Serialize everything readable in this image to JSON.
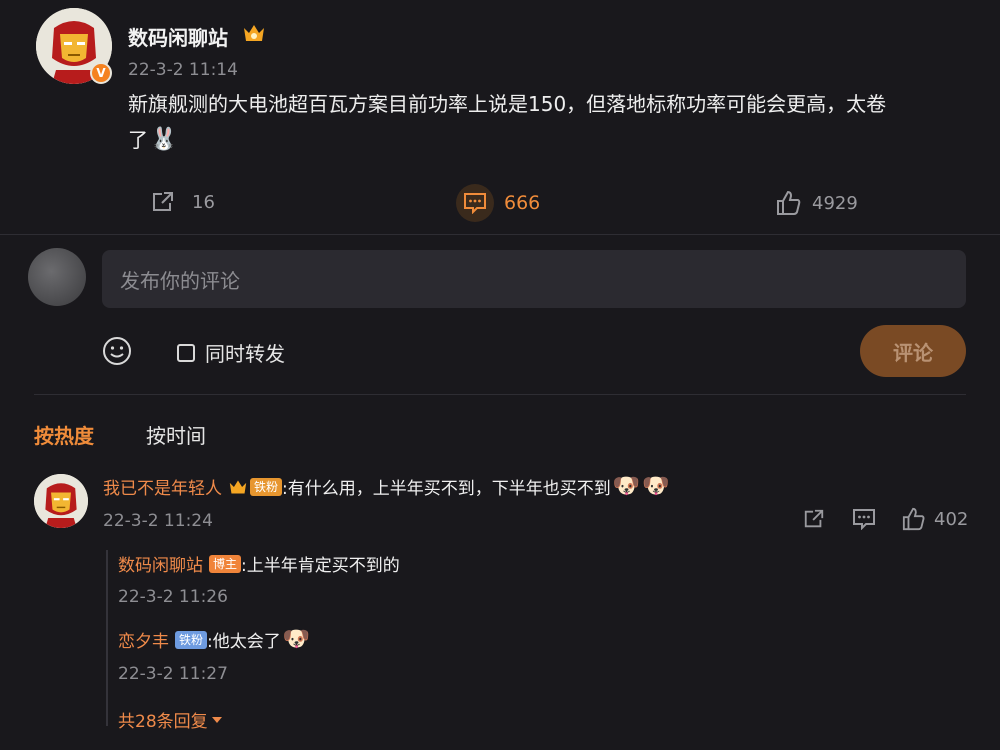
{
  "post": {
    "author": "数码闲聊站",
    "verified_badge": "V",
    "time": "22-3-2 11:14",
    "text_line1": "新旗舰测的大电池超百瓦方案目前功率上说是150，但落地标称功率可能会更高，太卷",
    "text_line2": "了",
    "emoji_text": "🐰",
    "share_count": "16",
    "comment_count": "666",
    "like_count": "4929"
  },
  "composer": {
    "placeholder": "发布你的评论",
    "repost_label": "同时转发",
    "submit_label": "评论"
  },
  "sort_tabs": {
    "hot": "按热度",
    "time": "按时间"
  },
  "comments": [
    {
      "user": "我已不是年轻人",
      "fan_tag": "铁粉",
      "text": ":有什么用，上半年买不到，下半年也买不到",
      "emoji1": "🐶",
      "emoji2": "🐶",
      "time": "22-3-2 11:24",
      "like_count": "402",
      "replies": [
        {
          "user": "数码闲聊站",
          "tag": "博主",
          "text": ":上半年肯定买不到的",
          "time": "22-3-2 11:26"
        },
        {
          "user": "恋夕丰",
          "tag": "铁粉",
          "text": ":他太会了",
          "emoji": "🐶",
          "time": "22-3-2 11:27"
        }
      ],
      "more_replies": "共28条回复"
    }
  ],
  "colors": {
    "background": "#19181c",
    "accent": "#f08c3a",
    "username": "#ef8a4a",
    "fan_tag": "#6e9be0"
  }
}
